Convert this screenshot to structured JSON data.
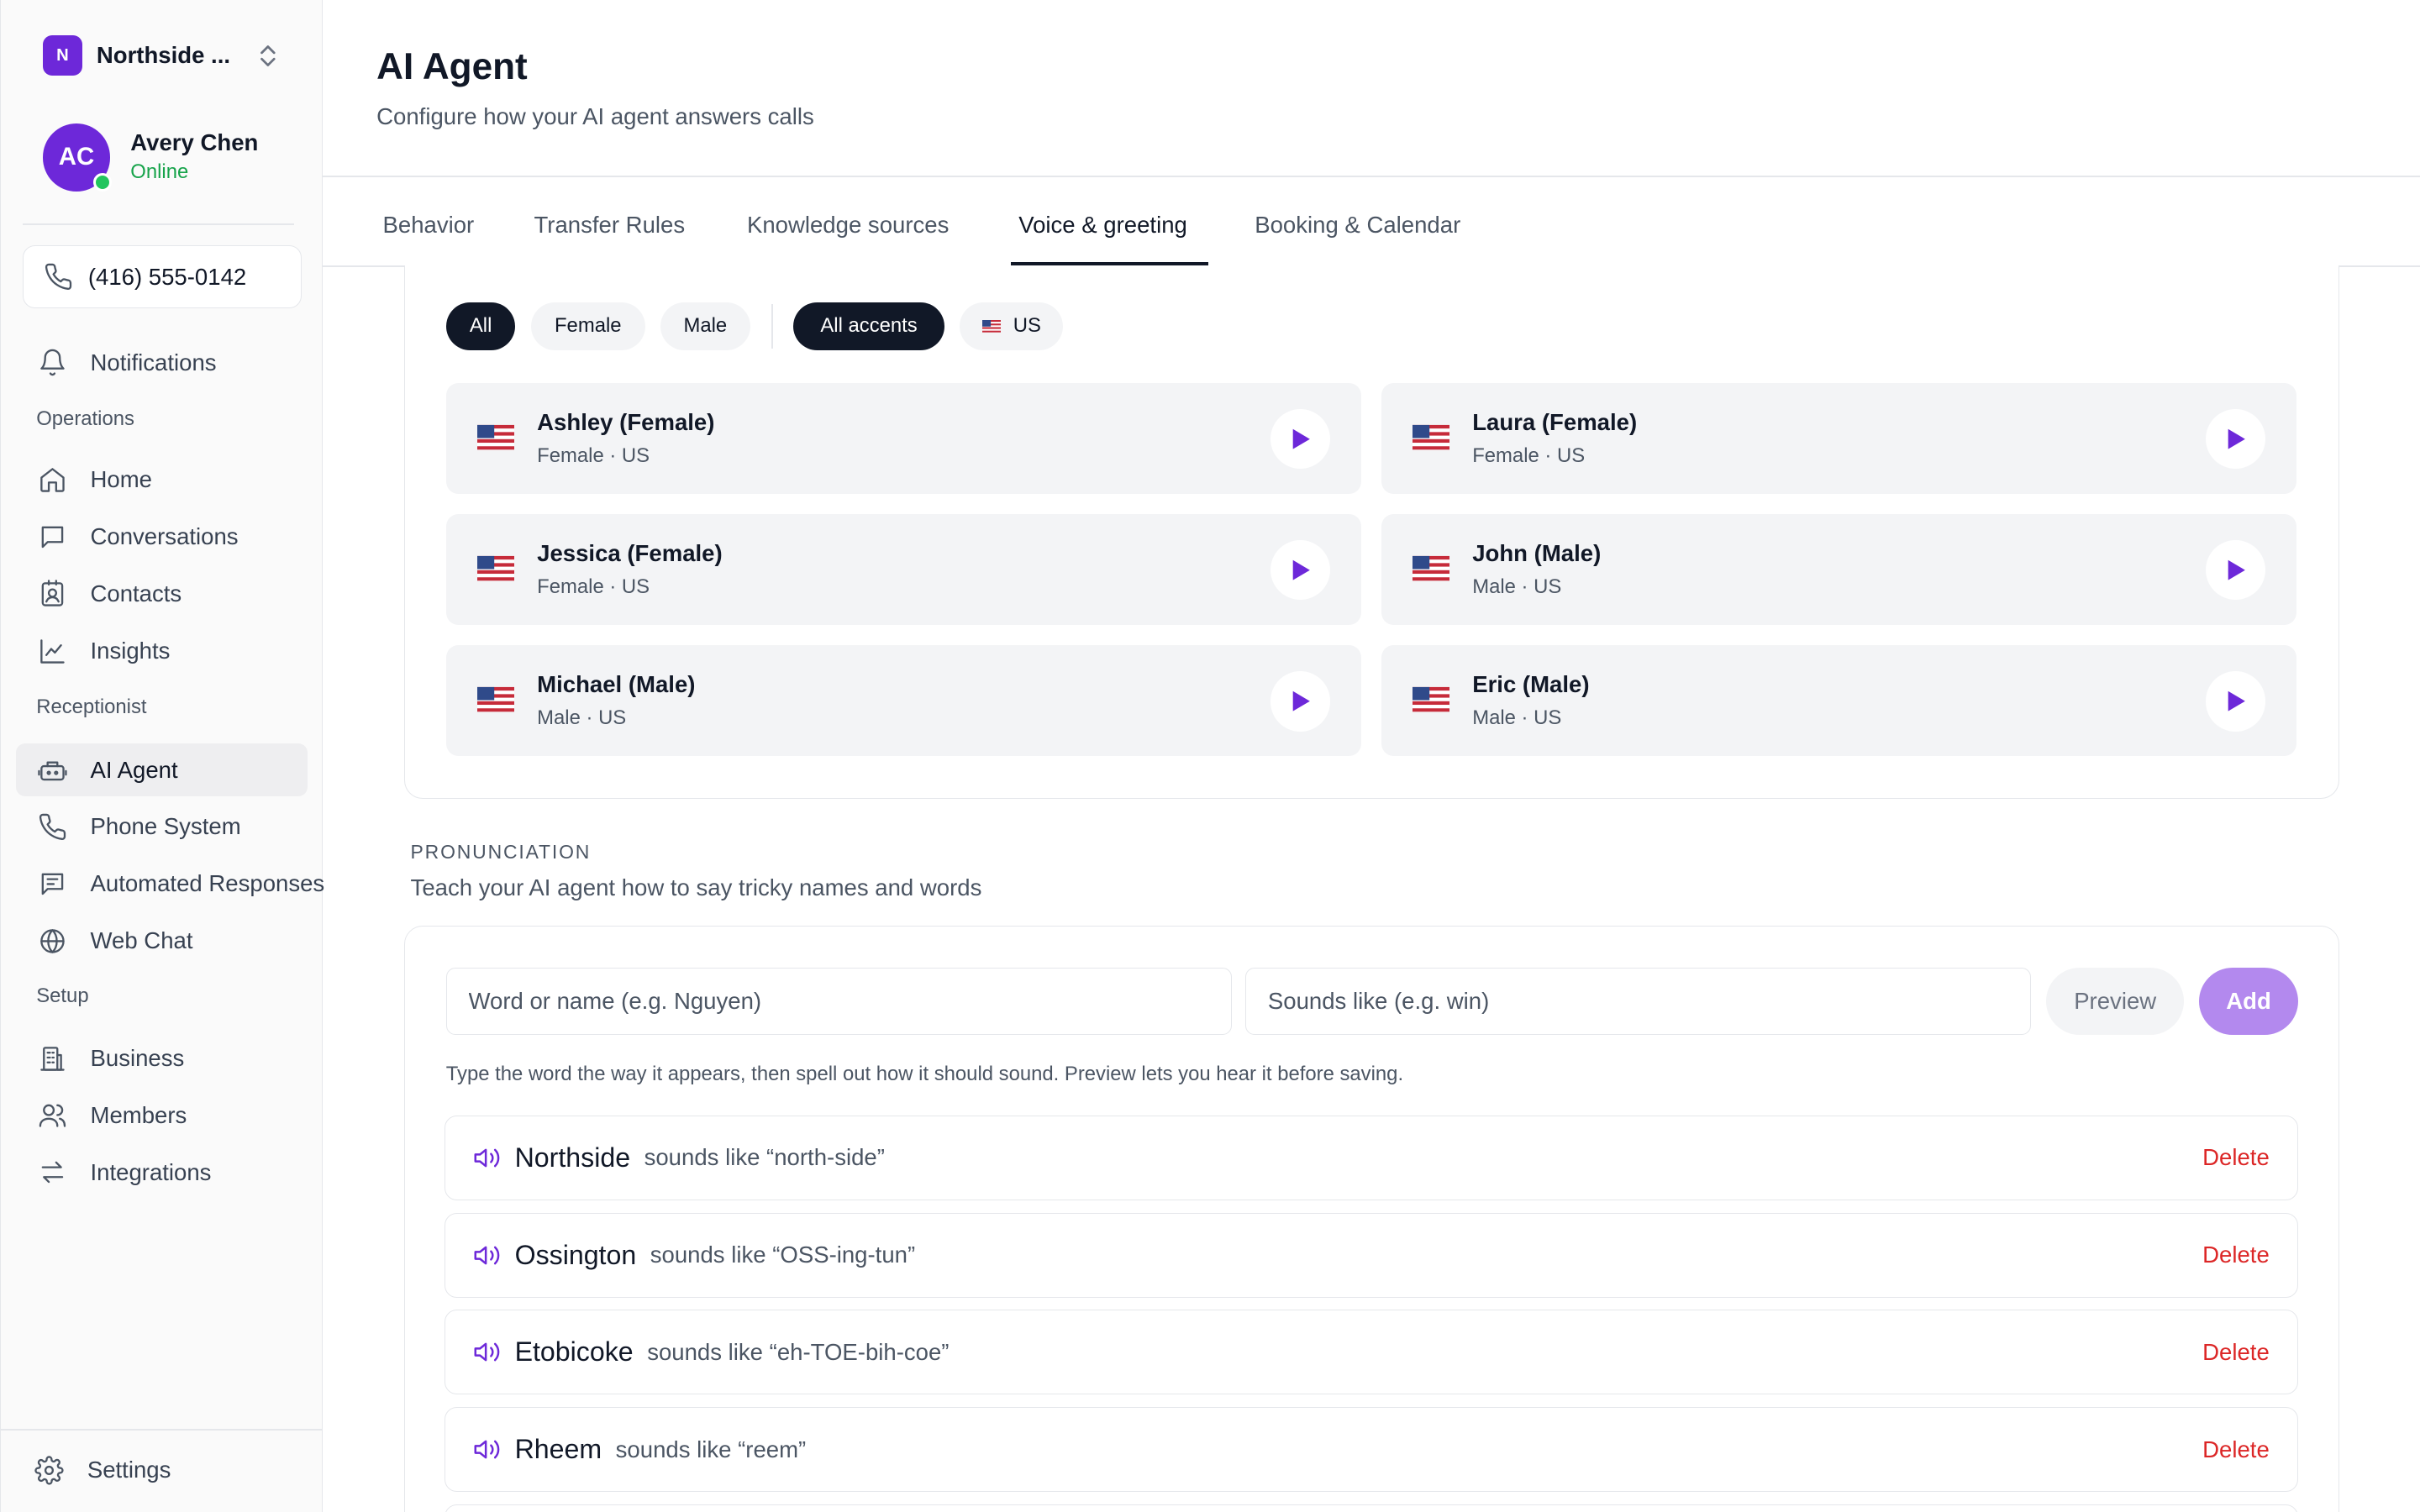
{
  "org": {
    "initial": "N",
    "name": "Northside ..."
  },
  "user": {
    "initials": "AC",
    "name": "Avery Chen",
    "status": "Online"
  },
  "phone": "(416) 555-0142",
  "nav": {
    "notifications": "Notifications",
    "section_operations": "Operations",
    "home": "Home",
    "conversations": "Conversations",
    "contacts": "Contacts",
    "insights": "Insights",
    "section_receptionist": "Receptionist",
    "ai_agent": "AI Agent",
    "phone_system": "Phone System",
    "automated_responses": "Automated Responses",
    "web_chat": "Web Chat",
    "section_setup": "Setup",
    "business": "Business",
    "members": "Members",
    "integrations": "Integrations",
    "settings": "Settings"
  },
  "header": {
    "title": "AI Agent",
    "subtitle": "Configure how your AI agent answers calls"
  },
  "tabs": [
    "Behavior",
    "Transfer Rules",
    "Knowledge sources",
    "Voice & greeting",
    "Booking & Calendar"
  ],
  "filters": {
    "gender": [
      "All",
      "Female",
      "Male"
    ],
    "accent_all": "All accents",
    "accent_us": "US"
  },
  "voices": [
    {
      "name": "Ashley (Female)",
      "meta": "Female · US"
    },
    {
      "name": "Laura (Female)",
      "meta": "Female · US"
    },
    {
      "name": "Jessica (Female)",
      "meta": "Female · US"
    },
    {
      "name": "John (Male)",
      "meta": "Male · US"
    },
    {
      "name": "Michael (Male)",
      "meta": "Male · US"
    },
    {
      "name": "Eric (Male)",
      "meta": "Male · US"
    }
  ],
  "pronunciation": {
    "heading": "PRONUNCIATION",
    "subtitle": "Teach your AI agent how to say tricky names and words",
    "word_placeholder": "Word or name (e.g. Nguyen)",
    "sounds_placeholder": "Sounds like (e.g. win)",
    "preview_label": "Preview",
    "add_label": "Add",
    "hint": "Type the word the way it appears, then spell out how it should sound. Preview lets you hear it before saving.",
    "delete_label": "Delete",
    "entries": [
      {
        "word": "Northside",
        "sounds": "sounds like “north-side”"
      },
      {
        "word": "Ossington",
        "sounds": "sounds like “OSS-ing-tun”"
      },
      {
        "word": "Etobicoke",
        "sounds": "sounds like “eh-TOE-bih-coe”"
      },
      {
        "word": "Rheem",
        "sounds": "sounds like “reem”"
      }
    ]
  },
  "colors": {
    "accent": "#6d28d9",
    "online": "#22c55e",
    "danger": "#dc2626",
    "add_button": "#b389ee"
  }
}
